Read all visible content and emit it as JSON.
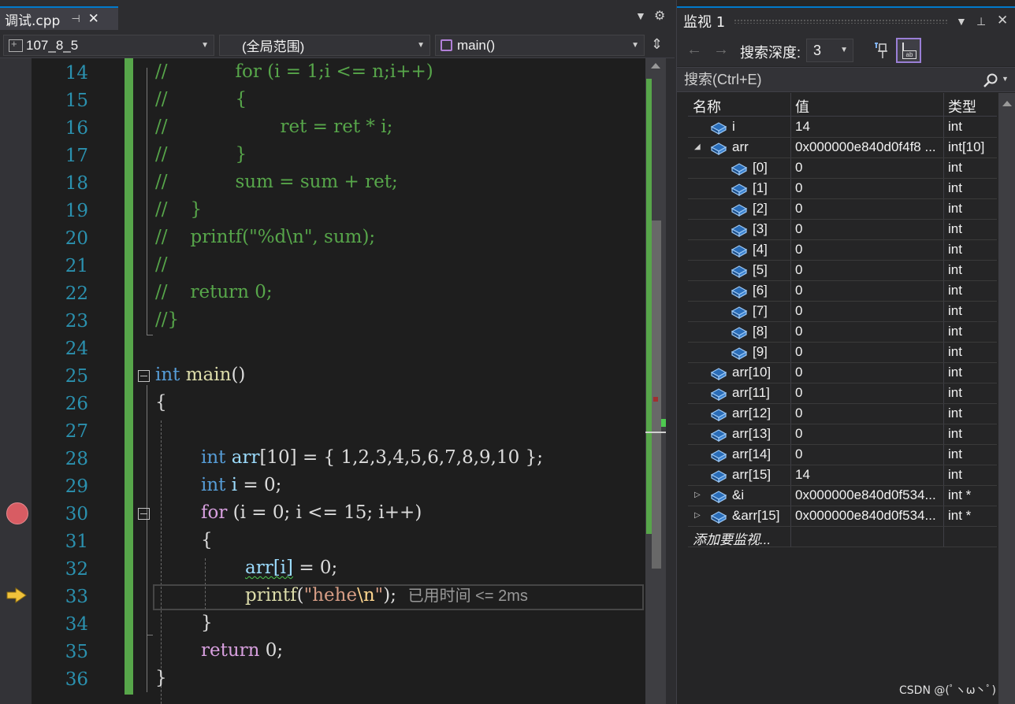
{
  "editor": {
    "tab": {
      "filename": "调试.cpp",
      "pin_glyph": "⊣",
      "close_glyph": "✕"
    },
    "nav": {
      "project": "107_8_5",
      "scope": "(全局范围)",
      "function": "main()"
    },
    "line_numbers": [
      "14",
      "15",
      "16",
      "17",
      "18",
      "19",
      "20",
      "21",
      "22",
      "23",
      "24",
      "25",
      "26",
      "27",
      "28",
      "29",
      "30",
      "31",
      "32",
      "33",
      "34",
      "35",
      "36"
    ],
    "lines": {
      "l14": {
        "a": "//",
        "b": "for (i = 1;i <= n;i++)"
      },
      "l15": {
        "a": "//",
        "b": "{"
      },
      "l16": {
        "a": "//",
        "b": "ret = ret * i;"
      },
      "l17": {
        "a": "//",
        "b": "}"
      },
      "l18": {
        "a": "//",
        "b": "sum = sum + ret;"
      },
      "l19": {
        "a": "//",
        "b": "}"
      },
      "l20": {
        "a": "//",
        "b": "printf(\"%d\\n\", sum);"
      },
      "l21": {
        "a": "//"
      },
      "l22": {
        "a": "//",
        "b": "return 0;"
      },
      "l23": {
        "a": "//}"
      },
      "l25": {
        "kw": "int",
        "fn": "main",
        "rest": "()"
      },
      "l26": {
        "t": "{"
      },
      "l28": {
        "kw": "int",
        "var": "arr",
        "rest": "[10] = { 1,2,3,4,5,6,7,8,9,10 };"
      },
      "l29": {
        "kw": "int",
        "var": "i",
        "rest": " = 0;"
      },
      "l30": {
        "kw": "for",
        "rest": " (i = 0; i <= 15; i++)"
      },
      "l31": {
        "t": "{"
      },
      "l32": {
        "var": "arr[i]",
        "rest": " = 0;"
      },
      "l33": {
        "fn": "printf",
        "open": "(",
        "str1": "\"hehe",
        "esc": "\\n",
        "str2": "\"",
        "rest": ");",
        "perf": "已用时间 <= 2ms"
      },
      "l34": {
        "t": "}"
      },
      "l35": {
        "kw": "return",
        "rest": " 0;"
      },
      "l36": {
        "t": "}"
      }
    }
  },
  "watch": {
    "title": "监视 1",
    "toolbar": {
      "depth_label": "搜索深度:",
      "depth_value": "3"
    },
    "search": {
      "placeholder": "搜索(Ctrl+E)"
    },
    "columns": {
      "name": "名称",
      "value": "值",
      "type": "类型"
    },
    "rows": [
      {
        "name": "i",
        "value": "14",
        "type": "int",
        "indent": 0,
        "expander": ""
      },
      {
        "name": "arr",
        "value": "0x000000e840d0f4f8 ...",
        "type": "int[10]",
        "indent": 0,
        "expander": "◢"
      },
      {
        "name": "[0]",
        "value": "0",
        "type": "int",
        "indent": 1,
        "expander": ""
      },
      {
        "name": "[1]",
        "value": "0",
        "type": "int",
        "indent": 1,
        "expander": ""
      },
      {
        "name": "[2]",
        "value": "0",
        "type": "int",
        "indent": 1,
        "expander": ""
      },
      {
        "name": "[3]",
        "value": "0",
        "type": "int",
        "indent": 1,
        "expander": ""
      },
      {
        "name": "[4]",
        "value": "0",
        "type": "int",
        "indent": 1,
        "expander": ""
      },
      {
        "name": "[5]",
        "value": "0",
        "type": "int",
        "indent": 1,
        "expander": ""
      },
      {
        "name": "[6]",
        "value": "0",
        "type": "int",
        "indent": 1,
        "expander": ""
      },
      {
        "name": "[7]",
        "value": "0",
        "type": "int",
        "indent": 1,
        "expander": ""
      },
      {
        "name": "[8]",
        "value": "0",
        "type": "int",
        "indent": 1,
        "expander": ""
      },
      {
        "name": "[9]",
        "value": "0",
        "type": "int",
        "indent": 1,
        "expander": ""
      },
      {
        "name": "arr[10]",
        "value": "0",
        "type": "int",
        "indent": 0,
        "expander": ""
      },
      {
        "name": "arr[11]",
        "value": "0",
        "type": "int",
        "indent": 0,
        "expander": ""
      },
      {
        "name": "arr[12]",
        "value": "0",
        "type": "int",
        "indent": 0,
        "expander": ""
      },
      {
        "name": "arr[13]",
        "value": "0",
        "type": "int",
        "indent": 0,
        "expander": ""
      },
      {
        "name": "arr[14]",
        "value": "0",
        "type": "int",
        "indent": 0,
        "expander": ""
      },
      {
        "name": "arr[15]",
        "value": "14",
        "type": "int",
        "indent": 0,
        "expander": ""
      },
      {
        "name": "&i",
        "value": "0x000000e840d0f534...",
        "type": "int *",
        "indent": 0,
        "expander": "▷"
      },
      {
        "name": "&arr[15]",
        "value": "0x000000e840d0f534...",
        "type": "int *",
        "indent": 0,
        "expander": "▷"
      }
    ],
    "add_watch": "添加要监视..."
  },
  "watermark": "CSDN @(ﾟヽω丶ﾟ)",
  "colors": {
    "comment": "#57a64a",
    "keyword": "#569cd6",
    "control": "#d8a0df",
    "function": "#dcdcaa",
    "string": "#d69d85",
    "breakpoint": "#d85c63",
    "accent": "#007acc"
  }
}
